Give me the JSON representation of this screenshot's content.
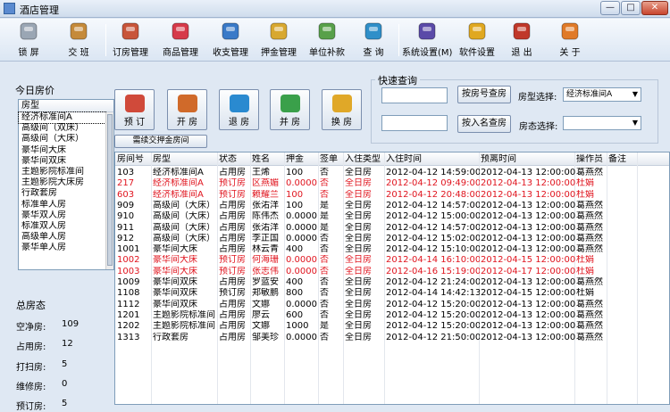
{
  "window": {
    "title": "酒店管理",
    "min": "—",
    "max": "□",
    "close": "✕"
  },
  "toolbar": {
    "items": [
      {
        "label": "锁 屏",
        "icon": "key-icon",
        "color": "#9aa6b4"
      },
      {
        "label": "交 班",
        "icon": "moneybag-icon",
        "color": "#c58a3a"
      },
      {
        "label": "订房管理",
        "icon": "house-icon",
        "color": "#c8553a"
      },
      {
        "label": "商品管理",
        "icon": "cup-icon",
        "color": "#d63a4a"
      },
      {
        "label": "收支管理",
        "icon": "calculator-icon",
        "color": "#3a7ac8"
      },
      {
        "label": "押金管理",
        "icon": "coins-icon",
        "color": "#d8a830"
      },
      {
        "label": "单位补款",
        "icon": "card-icon",
        "color": "#58a04a"
      },
      {
        "label": "查 询",
        "icon": "magnifier-icon",
        "color": "#2f8fc9"
      },
      {
        "label": "系统设置(M)",
        "icon": "wizard-hat-icon",
        "color": "#5a4aa8"
      },
      {
        "label": "软件设置",
        "icon": "gear-icon",
        "color": "#e0a820"
      },
      {
        "label": "退 出",
        "icon": "exit-door-icon",
        "color": "#c0382a"
      },
      {
        "label": "关 于",
        "icon": "envelope-icon",
        "color": "#e07a28"
      }
    ]
  },
  "left": {
    "title": "今日房价",
    "list_header": "房型",
    "rooms": [
      "经济标准间A",
      "高级间（双床）",
      "高级间（大床）",
      "豪华间大床",
      "豪华间双床",
      "主题影院标准间",
      "主题影院大床房",
      "行政套房",
      "标准单人房",
      "豪华双人房",
      "标准双人房",
      "高级单人房",
      "豪华单人房"
    ],
    "summary_title": "总房态",
    "summary": [
      {
        "label": "空净房:",
        "value": "109"
      },
      {
        "label": "占用房:",
        "value": "12"
      },
      {
        "label": "打扫房:",
        "value": "5"
      },
      {
        "label": "维修房:",
        "value": "0"
      },
      {
        "label": "预订房:",
        "value": "5"
      }
    ]
  },
  "actions": [
    {
      "label": "预 订",
      "icon": "booking-icon",
      "color": "#d04a3a"
    },
    {
      "label": "开 房",
      "icon": "open-room-icon",
      "color": "#d06a2a"
    },
    {
      "label": "退 房",
      "icon": "checkout-icon",
      "color": "#2a8ad0"
    },
    {
      "label": "并 房",
      "icon": "merge-icon",
      "color": "#3aa04a"
    },
    {
      "label": "换 房",
      "icon": "swap-icon",
      "color": "#e0a828"
    }
  ],
  "deposit_button": "需续交押金房间",
  "query": {
    "title": "快速查询",
    "room_input": "",
    "room_button": "按房号查房",
    "room_type_label": "房型选择:",
    "room_type_value": "经济标准间A",
    "name_input": "",
    "name_button": "按入名查房",
    "room_status_label": "房态选择:",
    "room_status_value": ""
  },
  "grid": {
    "columns": [
      "房间号",
      "房型",
      "状态",
      "姓名",
      "押金",
      "签单",
      "入住类型",
      "入住时间",
      "预离时间",
      "操作员",
      "备注"
    ],
    "rows": [
      {
        "cells": [
          "103",
          "经济标准间A",
          "占用房",
          "王烯",
          "100",
          "否",
          "全日房",
          "2012-04-12 14:59:00",
          "2012-04-13 12:00:00",
          "葛燕然",
          ""
        ],
        "red": false
      },
      {
        "cells": [
          "217",
          "经济标准间A",
          "预订房",
          "区燕媚",
          "0.0000",
          "否",
          "全日房",
          "2012-04-12 09:49:00",
          "2012-04-13 12:00:00",
          "杜娟",
          ""
        ],
        "red": true
      },
      {
        "cells": [
          "603",
          "经济标准间A",
          "预订房",
          "赖耀兰",
          "100",
          "否",
          "全日房",
          "2012-04-12 20:48:00",
          "2012-04-13 12:00:00",
          "杜娟",
          ""
        ],
        "red": true
      },
      {
        "cells": [
          "909",
          "高级间（大床）",
          "占用房",
          "张㳓洋",
          "100",
          "是",
          "全日房",
          "2012-04-12 14:57:00",
          "2012-04-13 12:00:00",
          "葛燕然",
          ""
        ],
        "red": false
      },
      {
        "cells": [
          "910",
          "高级间（大床）",
          "占用房",
          "陈伟杰",
          "0.0000",
          "是",
          "全日房",
          "2012-04-12 15:00:00",
          "2012-04-13 12:00:00",
          "葛燕然",
          ""
        ],
        "red": false
      },
      {
        "cells": [
          "911",
          "高级间（大床）",
          "占用房",
          "张㳓洋",
          "0.0000",
          "是",
          "全日房",
          "2012-04-12 14:57:00",
          "2012-04-13 12:00:00",
          "葛燕然",
          ""
        ],
        "red": false
      },
      {
        "cells": [
          "912",
          "高级间（大床）",
          "占用房",
          "李正国",
          "0.0000",
          "否",
          "全日房",
          "2012-04-12 15:02:00",
          "2012-04-13 12:00:00",
          "葛燕然",
          ""
        ],
        "red": false
      },
      {
        "cells": [
          "1001",
          "豪华间大床",
          "占用房",
          "林云青",
          "400",
          "否",
          "全日房",
          "2012-04-12 15:10:00",
          "2012-04-13 12:00:00",
          "葛燕然",
          ""
        ],
        "red": false
      },
      {
        "cells": [
          "1002",
          "豪华间大床",
          "预订房",
          "何海珊",
          "0.0000",
          "否",
          "全日房",
          "2012-04-14 16:10:00",
          "2012-04-15 12:00:00",
          "杜娟",
          ""
        ],
        "red": true
      },
      {
        "cells": [
          "1003",
          "豪华间大床",
          "预订房",
          "张志伟",
          "0.0000",
          "否",
          "全日房",
          "2012-04-16 15:19:00",
          "2012-04-17 12:00:00",
          "杜娟",
          ""
        ],
        "red": true
      },
      {
        "cells": [
          "1009",
          "豪华间双床",
          "占用房",
          "罗蓝安",
          "400",
          "否",
          "全日房",
          "2012-04-12 21:24:00",
          "2012-04-13 12:00:00",
          "葛燕然",
          ""
        ],
        "red": false
      },
      {
        "cells": [
          "1108",
          "豪华间双床",
          "预订房",
          "郑敏鹏",
          "800",
          "否",
          "全日房",
          "2012-04-14 14:42:13",
          "2012-04-15 12:00:00",
          "杜娟",
          ""
        ],
        "red": false
      },
      {
        "cells": [
          "1112",
          "豪华间双床",
          "占用房",
          "文娜",
          "0.0000",
          "否",
          "全日房",
          "2012-04-12 15:20:00",
          "2012-04-13 12:00:00",
          "葛燕然",
          ""
        ],
        "red": false
      },
      {
        "cells": [
          "1201",
          "主题影院标准间",
          "占用房",
          "廖云",
          "600",
          "否",
          "全日房",
          "2012-04-12 15:20:00",
          "2012-04-13 12:00:00",
          "葛燕然",
          ""
        ],
        "red": false
      },
      {
        "cells": [
          "1202",
          "主题影院标准间",
          "占用房",
          "文娜",
          "1000",
          "是",
          "全日房",
          "2012-04-12 15:20:00",
          "2012-04-13 12:00:00",
          "葛燕然",
          ""
        ],
        "red": false
      },
      {
        "cells": [
          "1313",
          "行政套房",
          "占用房",
          "邹美珍",
          "0.0000",
          "否",
          "全日房",
          "2012-04-12 21:50:00",
          "2012-04-13 12:00:00",
          "葛燕然",
          ""
        ],
        "red": false
      }
    ]
  }
}
